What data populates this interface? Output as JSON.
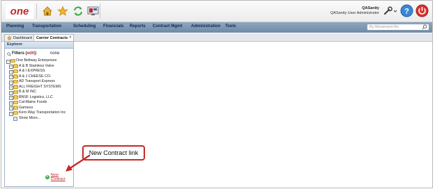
{
  "header": {
    "logo_text": "one",
    "user_name": "QASanity",
    "user_role": "QASanity User Administrator"
  },
  "nav": {
    "items": [
      "Planning",
      "Transportation",
      "Scheduling",
      "Financials",
      "Reports",
      "Contract Mgmt",
      "Administration",
      "Tools"
    ],
    "search_placeholder": "By Movement Re"
  },
  "tabs": [
    {
      "label": "Dashboard"
    },
    {
      "label": "Carrier Contracts"
    }
  ],
  "explorer": {
    "title": "Explorer",
    "filters_label": "Filters",
    "filters_edit": "edit",
    "filters_value": "none",
    "root": "One Beltway Enterprises",
    "children": [
      "A & B Stainless Valve",
      "A & I EXPRESS",
      "A & J CHEESE CO.",
      "AD Transport Express",
      "ALL FREIGHT SYSTEMS",
      "B & M INC",
      "BNSF Logistics, LLC",
      "Cal-Maine Foods",
      "Gamesa",
      "Kern-Way Transportation Inc"
    ],
    "show_more": "Show More...",
    "new_contract": "New Contract"
  },
  "callout": {
    "text": "New Contract link",
    "border_color": "#c62828"
  }
}
